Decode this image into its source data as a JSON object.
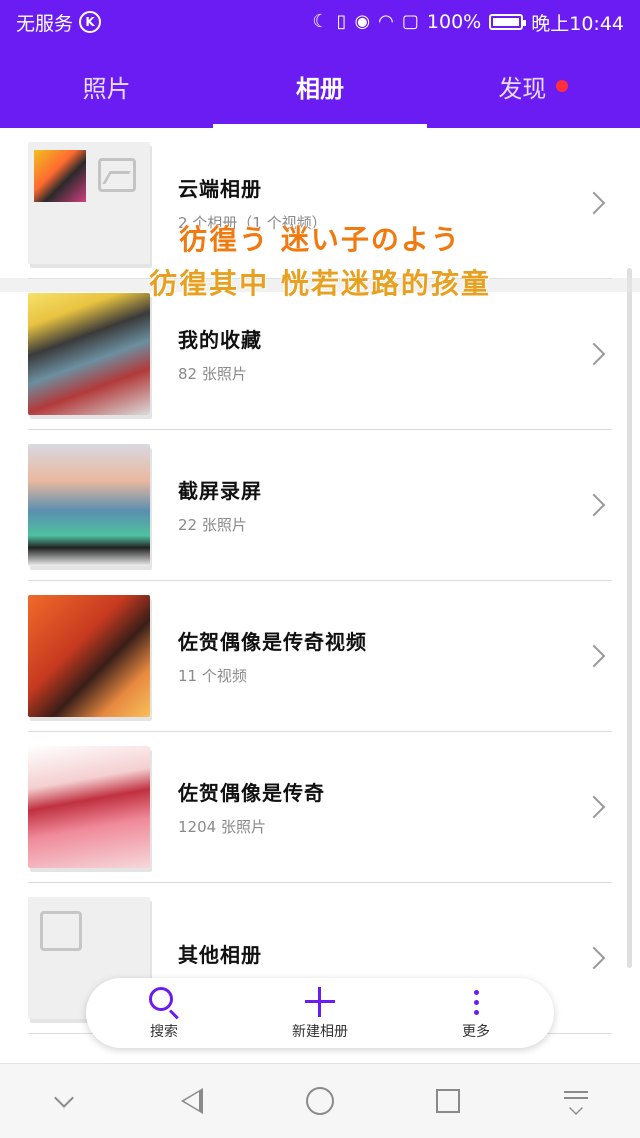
{
  "status_bar": {
    "carrier": "无服务",
    "time": "晚上10:44",
    "battery": "100%",
    "battery_level": 1.0
  },
  "tabs": [
    {
      "label": "照片",
      "active": false
    },
    {
      "label": "相册",
      "active": true
    },
    {
      "label": "发现",
      "active": false,
      "badge": "red-dot"
    }
  ],
  "albums": [
    {
      "title": "云端相册",
      "subtitle": "2 个相册（1 个视频）"
    },
    {
      "title": "我的收藏",
      "subtitle": "82 张照片"
    },
    {
      "title": "截屏录屏",
      "subtitle": "22 张照片"
    },
    {
      "title": "佐贺偶像是传奇视频",
      "subtitle": "11 个视频"
    },
    {
      "title": "佐贺偶像是传奇",
      "subtitle": "1204 张照片"
    },
    {
      "title": "其他相册",
      "subtitle": ""
    }
  ],
  "caption": {
    "line1": "彷徨う 迷い子のよう",
    "line2": "彷徨其中 恍若迷路的孩童"
  },
  "actions": {
    "search": "搜索",
    "new_album": "新建相册",
    "more": "更多"
  },
  "colors": {
    "accent": "#6a1cf2",
    "badge": "#ff2e3d",
    "caption_primary": "#f07a10",
    "caption_secondary": "#e8a020"
  }
}
